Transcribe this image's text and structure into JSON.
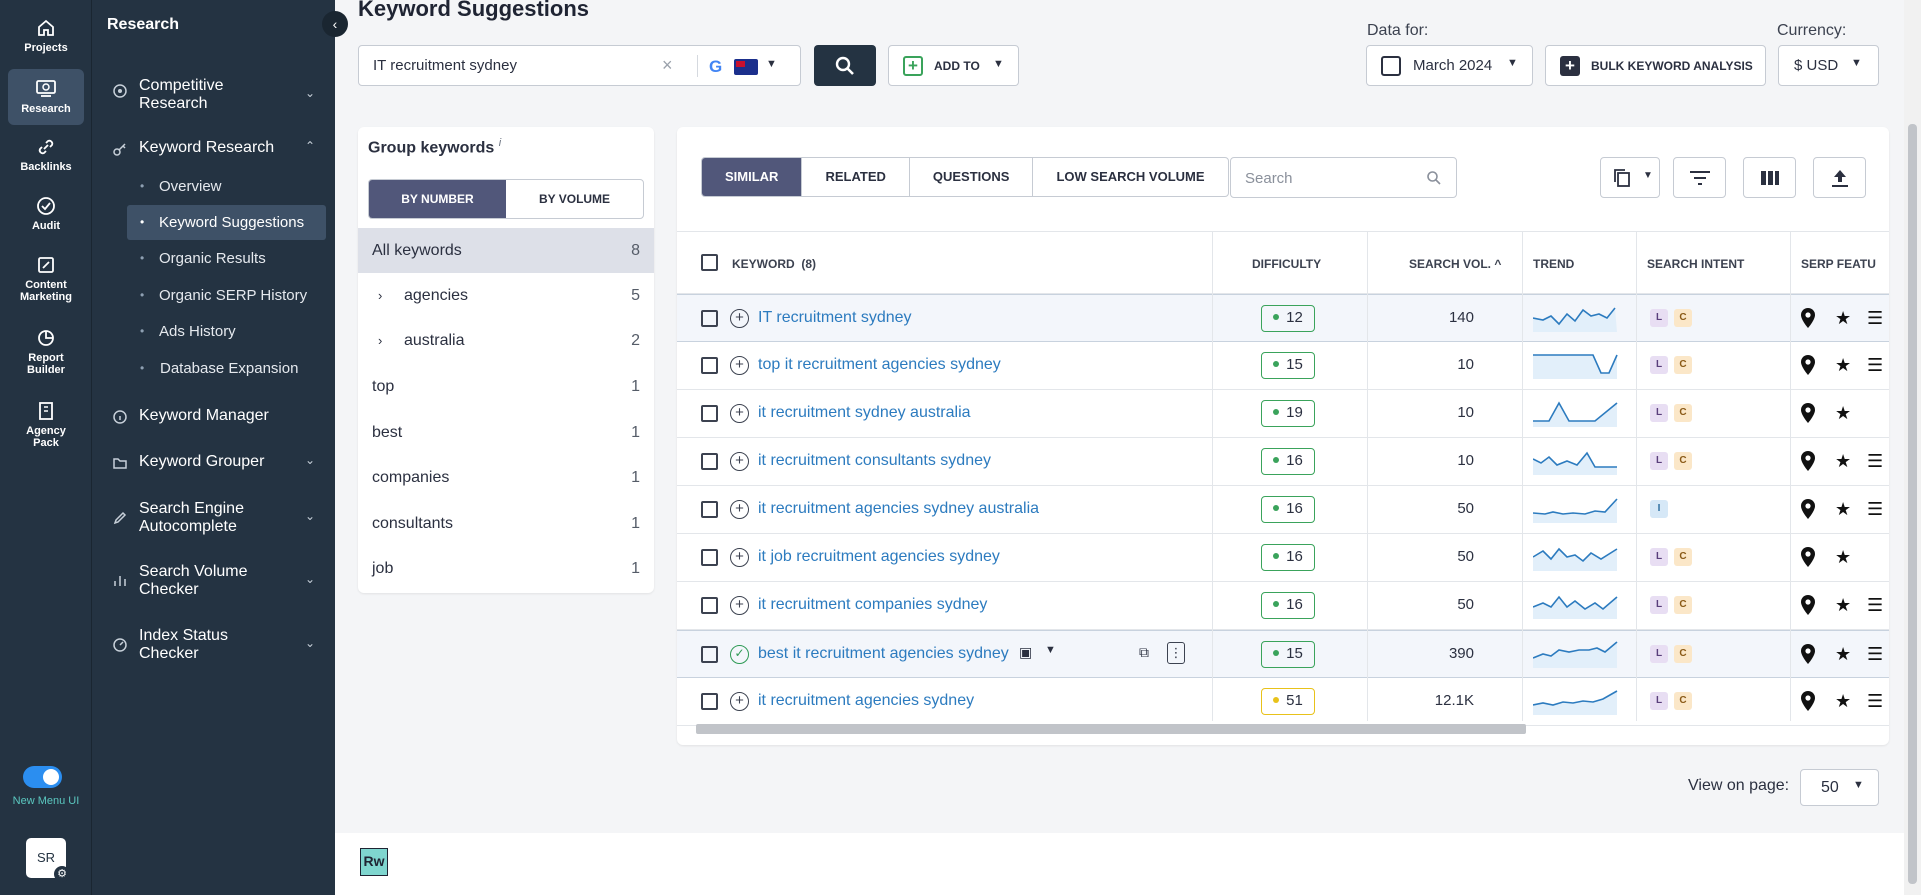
{
  "rail": {
    "items": [
      {
        "label": "Projects",
        "icon": "home-icon"
      },
      {
        "label": "Research",
        "icon": "research-icon"
      },
      {
        "label": "Backlinks",
        "icon": "link-icon"
      },
      {
        "label": "Audit",
        "icon": "check-circle-icon"
      },
      {
        "label": "Content Marketing",
        "icon": "edit-icon"
      },
      {
        "label": "Report Builder",
        "icon": "report-icon"
      },
      {
        "label": "Agency Pack",
        "icon": "building-icon"
      }
    ],
    "new_menu_label": "New Menu UI",
    "avatar_initials": "SR"
  },
  "sidebar": {
    "title": "Research",
    "items": [
      {
        "label": "Competitive Research",
        "icon": "target-icon"
      },
      {
        "label": "Keyword Research",
        "icon": "key-icon"
      },
      {
        "label": "Keyword Manager",
        "icon": "info-icon"
      },
      {
        "label": "Keyword Grouper",
        "icon": "folder-icon"
      },
      {
        "label": "Search Engine Autocomplete",
        "icon": "pen-icon"
      },
      {
        "label": "Search Volume Checker",
        "icon": "bar-chart-icon"
      },
      {
        "label": "Index Status Checker",
        "icon": "gauge-icon"
      }
    ],
    "subitems": [
      "Overview",
      "Keyword Suggestions",
      "Organic Results",
      "Organic SERP History",
      "Ads History",
      "Database Expansion"
    ]
  },
  "header": {
    "title": "Keyword Suggestions",
    "search_value": "IT recruitment sydney",
    "add_to_label": "ADD TO",
    "data_for_label": "Data for:",
    "date_value": "March 2024",
    "bulk_label": "BULK KEYWORD ANALYSIS",
    "currency_label": "Currency:",
    "currency_value": "$ USD"
  },
  "group_panel": {
    "title": "Group keywords",
    "info_mark": "i",
    "toggle_by_number": "BY NUMBER",
    "toggle_by_volume": "BY VOLUME",
    "groups": [
      {
        "label": "All keywords",
        "count": "8"
      },
      {
        "label": "agencies",
        "count": "5"
      },
      {
        "label": "australia",
        "count": "2"
      },
      {
        "label": "top",
        "count": "1"
      },
      {
        "label": "best",
        "count": "1"
      },
      {
        "label": "companies",
        "count": "1"
      },
      {
        "label": "consultants",
        "count": "1"
      },
      {
        "label": "job",
        "count": "1"
      }
    ]
  },
  "table": {
    "tabs": [
      "SIMILAR",
      "RELATED",
      "QUESTIONS",
      "LOW SEARCH VOLUME"
    ],
    "search_placeholder": "Search",
    "columns": {
      "keyword": "KEYWORD",
      "keyword_count": "(8)",
      "difficulty": "DIFFICULTY",
      "volume": "SEARCH VOL.",
      "trend": "TREND",
      "intent": "SEARCH INTENT",
      "serp": "SERP FEATU"
    },
    "rows": [
      {
        "keyword": "IT recruitment sydney",
        "difficulty": "12",
        "volume": "140",
        "intent": [
          "L",
          "C"
        ]
      },
      {
        "keyword": "top it recruitment agencies sydney",
        "difficulty": "15",
        "volume": "10",
        "intent": [
          "L",
          "C"
        ]
      },
      {
        "keyword": "it recruitment sydney australia",
        "difficulty": "19",
        "volume": "10",
        "intent": [
          "L",
          "C"
        ]
      },
      {
        "keyword": "it recruitment consultants sydney",
        "difficulty": "16",
        "volume": "10",
        "intent": [
          "L",
          "C"
        ]
      },
      {
        "keyword": "it recruitment agencies sydney australia",
        "difficulty": "16",
        "volume": "50",
        "intent": [
          "I"
        ]
      },
      {
        "keyword": "it job recruitment agencies sydney",
        "difficulty": "16",
        "volume": "50",
        "intent": [
          "L",
          "C"
        ]
      },
      {
        "keyword": "it recruitment companies sydney",
        "difficulty": "16",
        "volume": "50",
        "intent": [
          "L",
          "C"
        ]
      },
      {
        "keyword": "best it recruitment agencies sydney",
        "difficulty": "15",
        "volume": "390",
        "intent": [
          "L",
          "C"
        ]
      },
      {
        "keyword": "it recruitment agencies sydney",
        "difficulty": "51",
        "volume": "12.1K",
        "intent": [
          "L",
          "C"
        ]
      }
    ]
  },
  "footer": {
    "view_on_page_label": "View on page:",
    "view_on_page_value": "50",
    "logo_text": "Rw"
  },
  "colors": {
    "sidebar_bg": "#243342",
    "active_item_bg": "#3e5167",
    "tab_active": "#51577a",
    "link": "#2c7bbf",
    "difficulty_easy": "#3aa35b",
    "difficulty_medium": "#e8c21a"
  }
}
